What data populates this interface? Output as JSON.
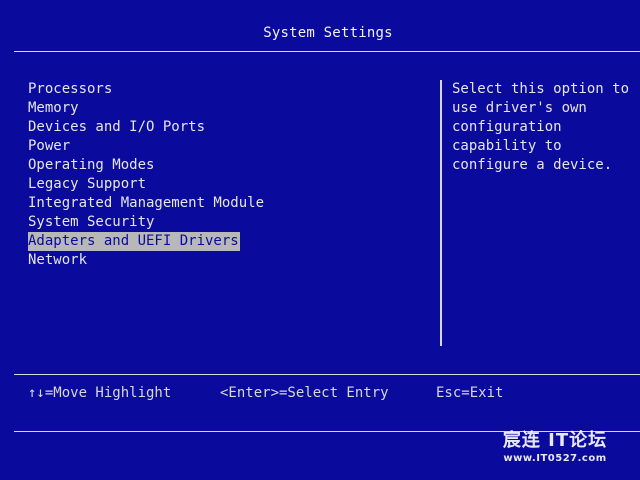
{
  "window": {
    "title": "System Settings"
  },
  "menu": {
    "items": [
      {
        "label": "Processors"
      },
      {
        "label": "Memory"
      },
      {
        "label": "Devices and I/O Ports"
      },
      {
        "label": "Power"
      },
      {
        "label": "Operating Modes"
      },
      {
        "label": "Legacy Support"
      },
      {
        "label": "Integrated Management Module"
      },
      {
        "label": "System Security"
      },
      {
        "label": "Adapters and UEFI Drivers"
      },
      {
        "label": "Network"
      }
    ],
    "selected_index": 8
  },
  "help": {
    "lines": [
      "Select this option to",
      "use driver's own",
      "configuration",
      "capability to",
      "configure a device."
    ]
  },
  "footer": {
    "move": "↑↓=Move Highlight",
    "select": "<Enter>=Select Entry",
    "exit": "Esc=Exit"
  },
  "watermark": {
    "top": "宸连 IT论坛",
    "bottom": "www.IT0527.com"
  },
  "colors": {
    "background": "#0a0a9c",
    "text": "#e6e6e6",
    "highlight_bg": "#b8b8b8"
  }
}
